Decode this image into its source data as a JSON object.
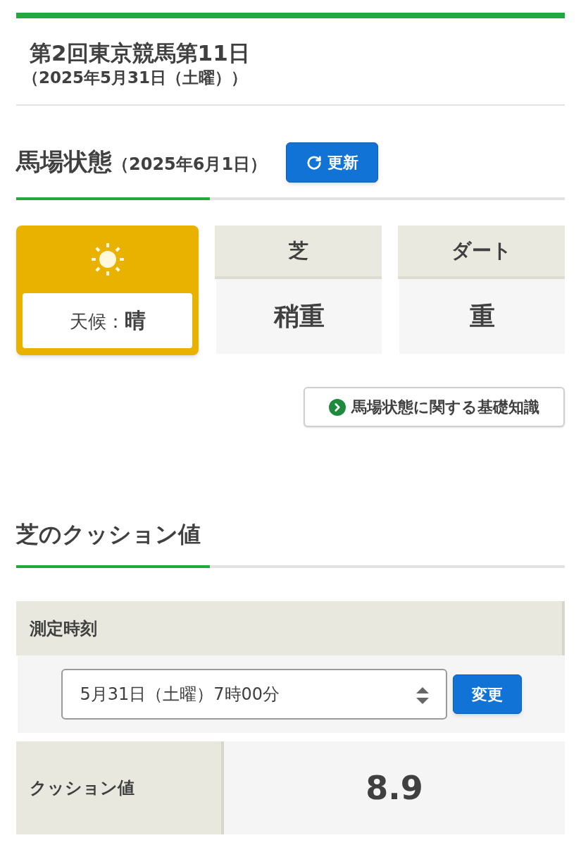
{
  "race_day": {
    "title": "第2回東京競馬第11日",
    "date": "（2025年5月31日（土曜））"
  },
  "track_condition": {
    "heading": "馬場状態",
    "date": "（2025年6月1日）",
    "refresh_button": "更新",
    "weather": {
      "label": "天候：",
      "value": "晴"
    },
    "surfaces": [
      {
        "name": "芝",
        "condition": "稍重"
      },
      {
        "name": "ダート",
        "condition": "重"
      }
    ],
    "info_link": "馬場状態に関する基礎知識"
  },
  "cushion": {
    "heading": "芝のクッション値",
    "time_label": "測定時刻",
    "time_select": {
      "value": "5月31日（土曜）7時00分"
    },
    "change_button": "変更",
    "value_label": "クッション値",
    "value": "8.9"
  }
}
